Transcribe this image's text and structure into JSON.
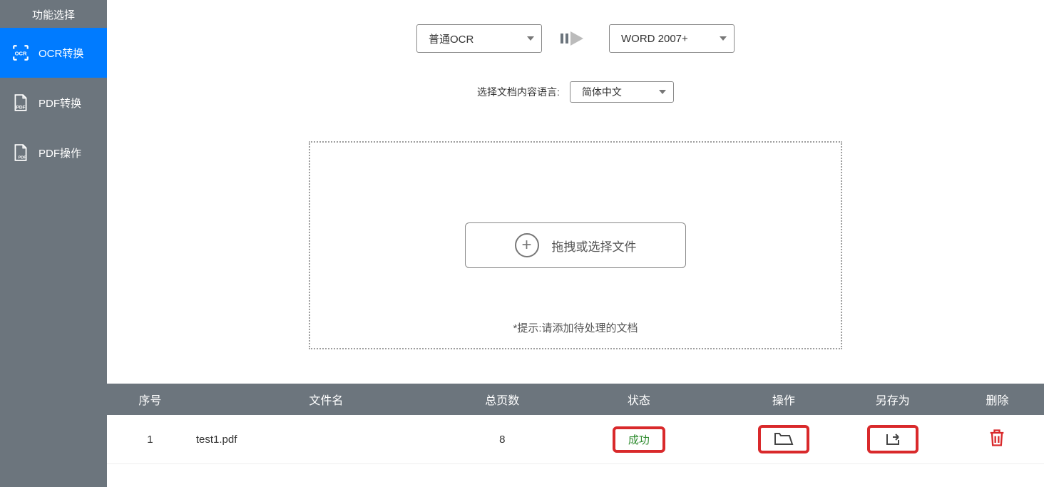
{
  "sidebar": {
    "header": "功能选择",
    "items": [
      {
        "label": "OCR转换"
      },
      {
        "label": "PDF转换"
      },
      {
        "label": "PDF操作"
      }
    ]
  },
  "conversion": {
    "source_mode": "普通OCR",
    "target_format": "WORD 2007+",
    "lang_label": "选择文档内容语言:",
    "language": "简体中文"
  },
  "dropzone": {
    "button_label": "拖拽或选择文件",
    "hint": "*提示:请添加待处理的文档"
  },
  "table": {
    "headers": {
      "seq": "序号",
      "name": "文件名",
      "pages": "总页数",
      "status": "状态",
      "action": "操作",
      "saveas": "另存为",
      "delete": "删除"
    },
    "rows": [
      {
        "seq": "1",
        "name": "test1.pdf",
        "pages": "8",
        "status": "成功"
      }
    ]
  }
}
